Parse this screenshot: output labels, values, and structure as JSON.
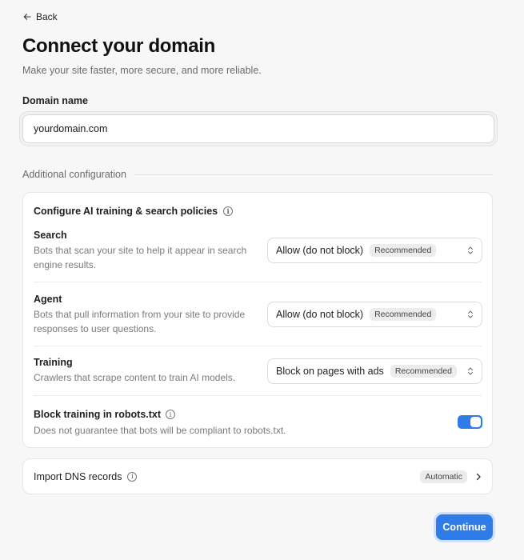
{
  "nav": {
    "back_label": "Back"
  },
  "header": {
    "title": "Connect your domain",
    "subtitle": "Make your site faster, more secure, and more reliable."
  },
  "domain": {
    "label": "Domain name",
    "value": "yourdomain.com"
  },
  "additional": {
    "section_label": "Additional configuration",
    "ai_card": {
      "title": "Configure AI training & search policies",
      "policies": [
        {
          "title": "Search",
          "description": "Bots that scan your site to help it appear in search engine results.",
          "selected": "Allow (do not block)",
          "badge": "Recommended"
        },
        {
          "title": "Agent",
          "description": "Bots that pull information from your site to provide responses to user questions.",
          "selected": "Allow (do not block)",
          "badge": "Recommended"
        },
        {
          "title": "Training",
          "description": "Crawlers that scrape content to train AI models.",
          "selected": "Block on pages with ads",
          "badge": "Recommended"
        }
      ],
      "robots": {
        "title": "Block training in robots.txt",
        "description": "Does not guarantee that bots will be compliant to robots.txt.",
        "enabled": true
      }
    },
    "dns": {
      "label": "Import DNS records",
      "badge": "Automatic"
    }
  },
  "footer": {
    "continue_label": "Continue"
  },
  "colors": {
    "accent": "#2f7be8",
    "text_muted": "#7a7a7a"
  }
}
